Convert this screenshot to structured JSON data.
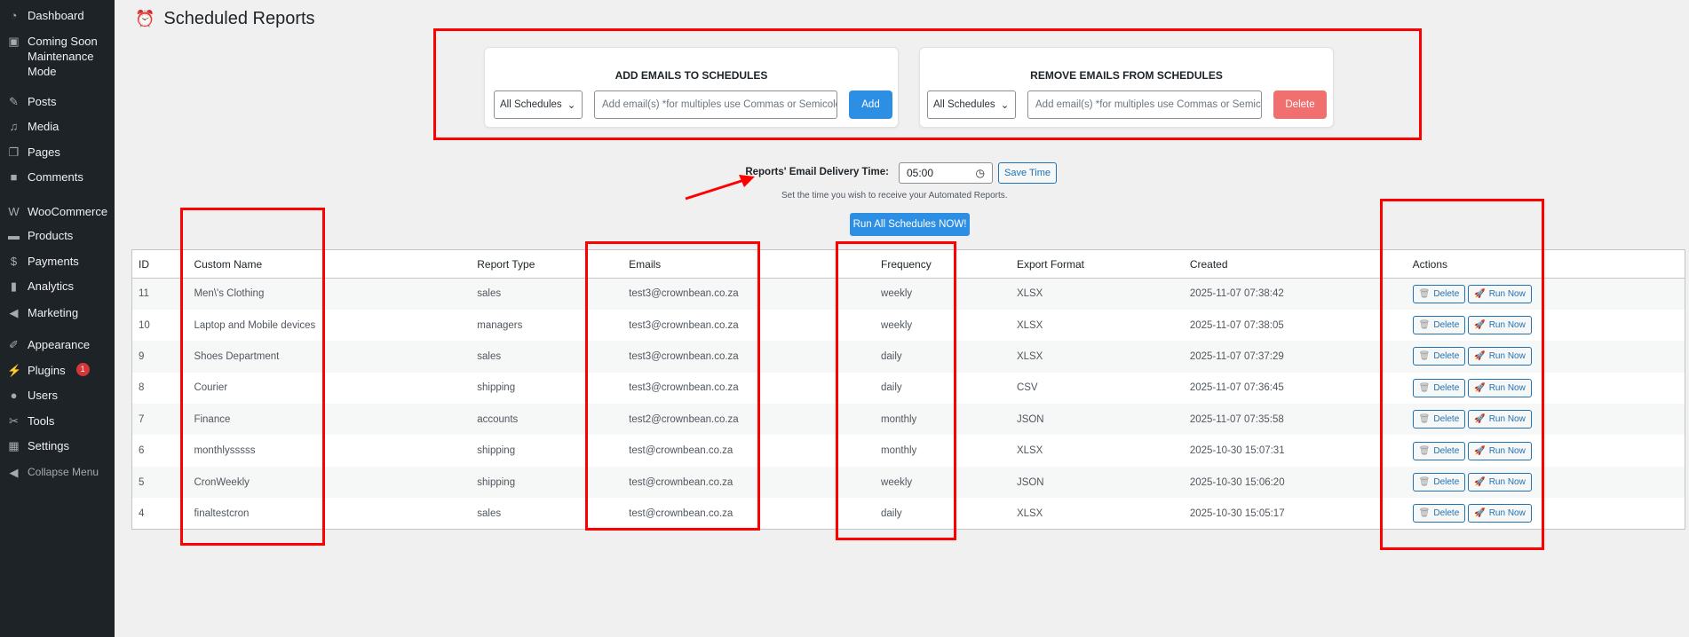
{
  "sidebar": {
    "items": [
      {
        "label": "Dashboard",
        "icon": "dashboard-icon",
        "glyph": "◔"
      },
      {
        "label": "Coming Soon Maintenance Mode",
        "icon": "coming-soon-icon",
        "glyph": "▣"
      },
      {
        "label": "Posts",
        "icon": "pin-icon",
        "glyph": "✎"
      },
      {
        "label": "Media",
        "icon": "media-icon",
        "glyph": "♫"
      },
      {
        "label": "Pages",
        "icon": "pages-icon",
        "glyph": "❐"
      },
      {
        "label": "Comments",
        "icon": "comment-icon",
        "glyph": "■"
      },
      {
        "label": "WooCommerce",
        "icon": "woocommerce-icon",
        "glyph": "W"
      },
      {
        "label": "Products",
        "icon": "archive-icon",
        "glyph": "▬"
      },
      {
        "label": "Payments",
        "icon": "payments-icon",
        "glyph": "$"
      },
      {
        "label": "Analytics",
        "icon": "bar-chart-icon",
        "glyph": "▮"
      },
      {
        "label": "Marketing",
        "icon": "megaphone-icon",
        "glyph": "◀"
      },
      {
        "label": "Appearance",
        "icon": "brush-icon",
        "glyph": "✐"
      },
      {
        "label": "Plugins",
        "icon": "plugin-icon",
        "glyph": "⚡",
        "badge": "1"
      },
      {
        "label": "Users",
        "icon": "user-icon",
        "glyph": "●"
      },
      {
        "label": "Tools",
        "icon": "wrench-icon",
        "glyph": "✂"
      },
      {
        "label": "Settings",
        "icon": "settings-icon",
        "glyph": "▦"
      },
      {
        "label": "Collapse Menu",
        "icon": "collapse-icon",
        "glyph": "◀"
      }
    ]
  },
  "page": {
    "title": "Scheduled Reports"
  },
  "add_card": {
    "title": "ADD EMAILS TO SCHEDULES",
    "select": "All Schedules",
    "placeholder": "Add email(s) *for multiples use Commas or Semicolons",
    "button": "Add"
  },
  "remove_card": {
    "title": "REMOVE EMAILS FROM SCHEDULES",
    "select": "All Schedules",
    "placeholder": "Add email(s) *for multiples use Commas or Semicolons",
    "button": "Delete"
  },
  "delivery": {
    "label": "Reports' Email Delivery Time:",
    "value": "05:00",
    "save": "Save Time",
    "help": "Set the time you wish to receive your Automated Reports."
  },
  "run_all": "Run All Schedules NOW!",
  "table": {
    "headers": [
      "ID",
      "Custom Name",
      "Report Type",
      "Emails",
      "Frequency",
      "Export Format",
      "Created",
      "Actions"
    ],
    "delete_label": "Delete",
    "run_label": "Run Now",
    "rows": [
      [
        "11",
        "Men\\'s Clothing",
        "sales",
        "test3@crownbean.co.za",
        "weekly",
        "XLSX",
        "2025-11-07 07:38:42"
      ],
      [
        "10",
        "Laptop and Mobile devices",
        "managers",
        "test3@crownbean.co.za",
        "weekly",
        "XLSX",
        "2025-11-07 07:38:05"
      ],
      [
        "9",
        "Shoes Department",
        "sales",
        "test3@crownbean.co.za",
        "daily",
        "XLSX",
        "2025-11-07 07:37:29"
      ],
      [
        "8",
        "Courier",
        "shipping",
        "test3@crownbean.co.za",
        "daily",
        "CSV",
        "2025-11-07 07:36:45"
      ],
      [
        "7",
        "Finance",
        "accounts",
        "test2@crownbean.co.za",
        "monthly",
        "JSON",
        "2025-11-07 07:35:58"
      ],
      [
        "6",
        "monthlysssss",
        "shipping",
        "test@crownbean.co.za",
        "monthly",
        "XLSX",
        "2025-10-30 15:07:31"
      ],
      [
        "5",
        "CronWeekly",
        "shipping",
        "test@crownbean.co.za",
        "weekly",
        "JSON",
        "2025-10-30 15:06:20"
      ],
      [
        "4",
        "finaltestcron",
        "sales",
        "test@crownbean.co.za",
        "daily",
        "XLSX",
        "2025-10-30 15:05:17"
      ]
    ]
  },
  "colors": {
    "sidebar": "#1d2327",
    "add": "#2d8fe3",
    "delete": "#f07070",
    "annotation": "#ff0000",
    "link": "#2271b1"
  }
}
